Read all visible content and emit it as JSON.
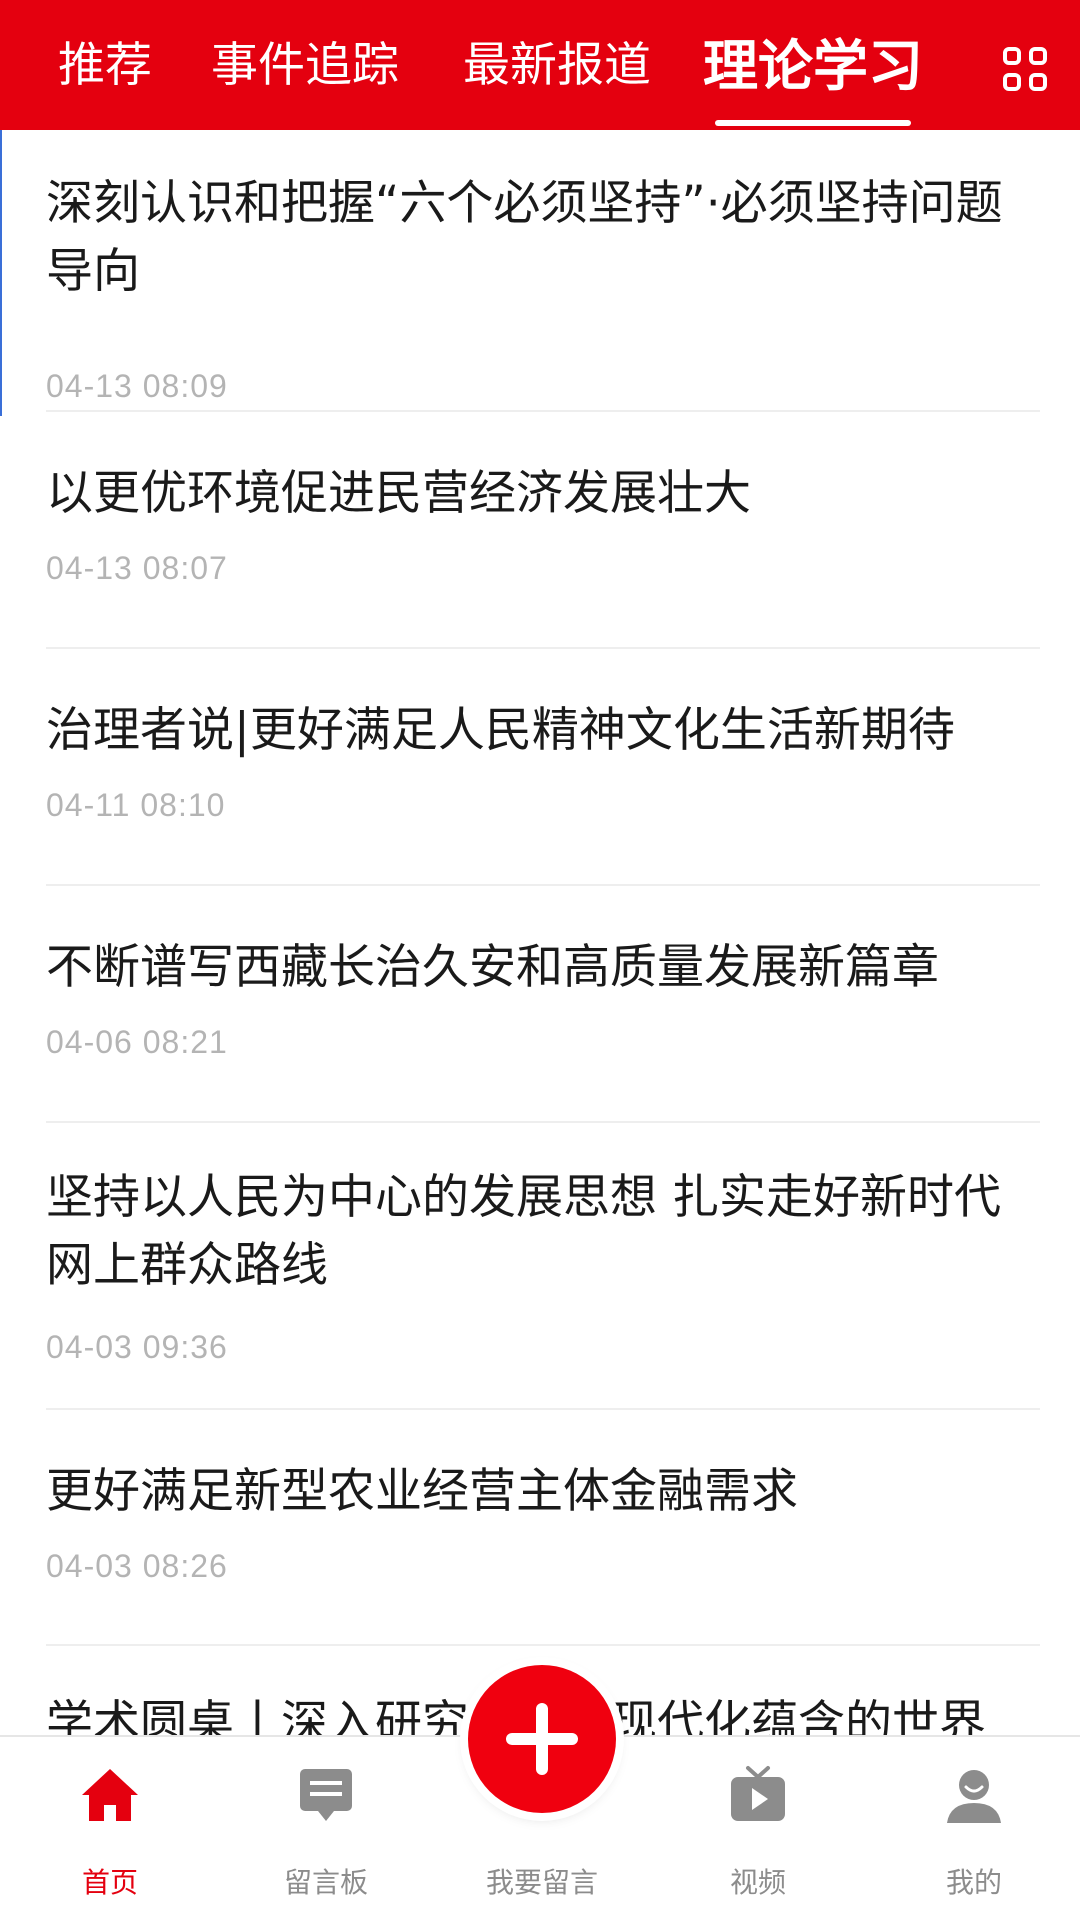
{
  "header": {
    "tabs": [
      {
        "label": "推荐",
        "active": false
      },
      {
        "label": "事件追踪",
        "active": false
      },
      {
        "label": "最新报道",
        "active": false
      },
      {
        "label": "理论学习",
        "active": true
      }
    ],
    "menu_icon": "grid-icon"
  },
  "news": [
    {
      "title": "深刻认识和把握“六个必须坚持”·必须坚持问题导向",
      "time": "04-13 08:09"
    },
    {
      "title": "以更优环境促进民营经济发展壮大",
      "time": "04-13 08:07"
    },
    {
      "title": "治理者说|更好满足人民精神文化生活新期待",
      "time": "04-11 08:10"
    },
    {
      "title": "不断谱写西藏长治久安和高质量发展新篇章",
      "time": "04-06 08:21"
    },
    {
      "title": "坚持以人民为中心的发展思想 扎实走好新时代网上群众路线",
      "time": "04-03 09:36"
    },
    {
      "title": "更好满足新型农业经营主体金融需求",
      "time": "04-03 08:26"
    },
    {
      "title": "学术圆桌丨深入研究中国式现代化蕴含的世界",
      "time": ""
    }
  ],
  "bottom_nav": {
    "items": [
      {
        "label": "首页",
        "icon": "home-icon",
        "active": true
      },
      {
        "label": "留言板",
        "icon": "message-board-icon",
        "active": false
      },
      {
        "label": "我要留言",
        "icon": "plus-icon",
        "active": false
      },
      {
        "label": "视频",
        "icon": "video-icon",
        "active": false
      },
      {
        "label": "我的",
        "icon": "user-icon",
        "active": false
      }
    ]
  },
  "colors": {
    "brand_red": "#e4000f",
    "inactive_gray": "#8c8c8c",
    "time_gray": "#b4b4b4"
  }
}
